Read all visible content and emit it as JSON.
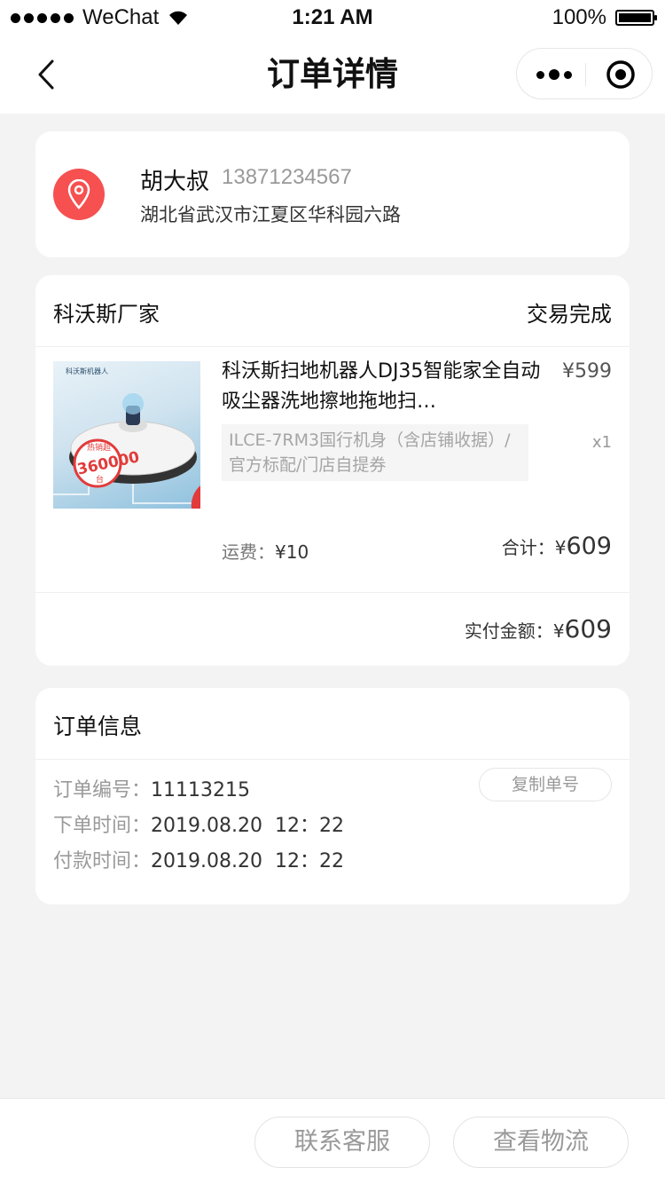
{
  "status_bar": {
    "carrier": "WeChat",
    "time": "1:21 AM",
    "battery": "100%"
  },
  "nav": {
    "title": "订单详情"
  },
  "address": {
    "name": "胡大叔",
    "phone": "13871234567",
    "detail": "湖北省武汉市江夏区华科园六路"
  },
  "order": {
    "shop_name": "科沃斯厂家",
    "status": "交易完成",
    "product": {
      "title": "科沃斯扫地机器人DJ35智能家全自动吸尘器洗地擦地拖地扫…",
      "price": "¥599",
      "spec": "ILCE-7RM3国行机身（含店铺收据）/官方标配/门店自提券",
      "qty": "x1",
      "image_text": {
        "brand": "科沃斯机器人",
        "badge": "热销超",
        "count": "360000",
        "unit": "台"
      }
    },
    "freight_label": "运费：",
    "freight_value": "¥10",
    "subtotal_label": "合计：",
    "subtotal_currency": "¥",
    "subtotal_value": "609",
    "paid_label": "实付金额：",
    "paid_currency": "¥",
    "paid_value": "609"
  },
  "order_info": {
    "title": "订单信息",
    "copy_button": "复制单号",
    "rows": [
      {
        "label": "订单编号：",
        "value": "11113215"
      },
      {
        "label": "下单时间：",
        "value": "2019.08.20  12：22"
      },
      {
        "label": "付款时间：",
        "value": "2019.08.20  12：22"
      }
    ]
  },
  "bottom_bar": {
    "contact_service": "联系客服",
    "view_logistics": "查看物流"
  },
  "colors": {
    "accent": "#f65050",
    "page_bg": "#f3f3f3",
    "card_bg": "#ffffff"
  },
  "icons": [
    "signal-dots-icon",
    "wifi-icon",
    "battery-icon",
    "back-chevron-icon",
    "more-dots-icon",
    "close-target-icon",
    "location-pin-icon"
  ]
}
